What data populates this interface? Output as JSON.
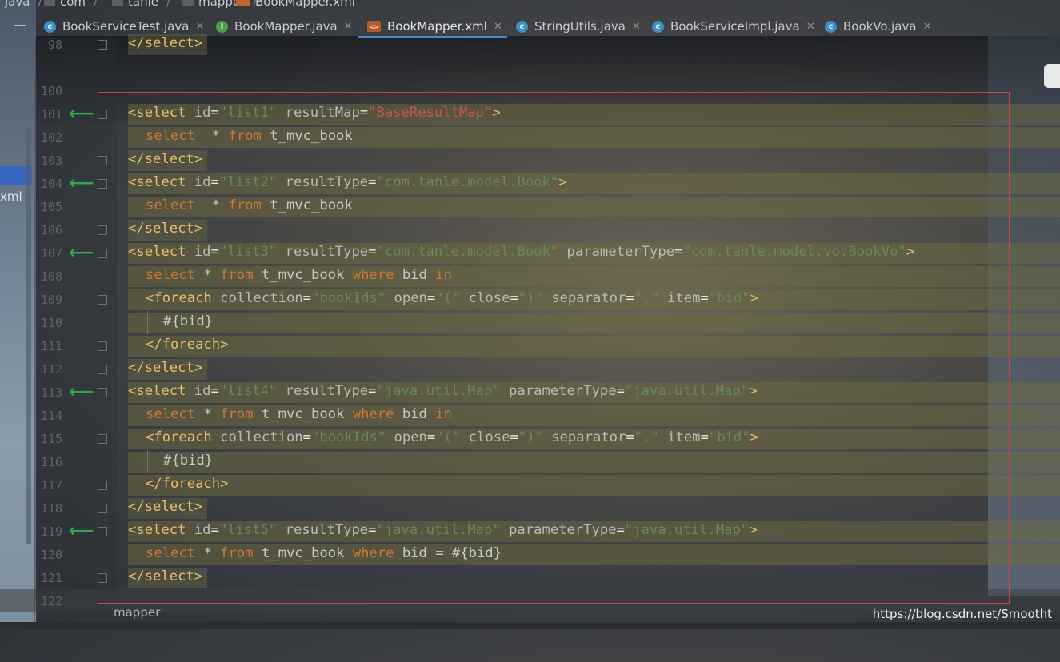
{
  "breadcrumb": [
    "java",
    "com",
    "tanle",
    "mapper",
    "BookMapper.xml"
  ],
  "tabs": [
    {
      "label": "BookServiceTest.java",
      "icon": "class-icon",
      "active": false
    },
    {
      "label": "BookMapper.java",
      "icon": "interface-icon",
      "active": false
    },
    {
      "label": "BookMapper.xml",
      "icon": "xml-file-icon",
      "active": true
    },
    {
      "label": "StringUtils.java",
      "icon": "class-icon",
      "active": false
    },
    {
      "label": "BookServiceImpl.java",
      "icon": "class-icon",
      "active": false
    },
    {
      "label": "BookVo.java",
      "icon": "class-icon",
      "active": false
    }
  ],
  "side_label": "xml",
  "line_numbers": [
    "98",
    "100",
    "101",
    "102",
    "103",
    "104",
    "105",
    "106",
    "107",
    "108",
    "109",
    "110",
    "111",
    "112",
    "113",
    "114",
    "115",
    "116",
    "117",
    "118",
    "119",
    "120",
    "121",
    "122"
  ],
  "code": {
    "l98": "</select>",
    "l101": {
      "open": "<select",
      "id_attr": "id",
      "id_val": "\"list1\"",
      "rm_attr": "resultMap",
      "rm_val": "\"BaseResultMap\"",
      "close": ">"
    },
    "l102": {
      "kw": "select",
      "rest": "  * ",
      "kw2": "from",
      "rest2": " t_mvc_book"
    },
    "l103": "</select>",
    "l104": {
      "open": "<select",
      "id_attr": "id",
      "id_val": "\"list2\"",
      "rt_attr": "resultType",
      "rt_val": "\"com.tanle.model.Book\"",
      "close": ">"
    },
    "l105": {
      "kw": "select",
      "rest": "  * ",
      "kw2": "from",
      "rest2": " t_mvc_book"
    },
    "l106": "</select>",
    "l107": {
      "open": "<select",
      "id_attr": "id",
      "id_val": "\"list3\"",
      "rt_attr": "resultType",
      "rt_val": "\"com.tanle.model.Book\"",
      "pt_attr": "parameterType",
      "pt_val": "\"com.tanle.model.vo.BookVo\"",
      "close": ">"
    },
    "l108": {
      "kw": "select",
      "rest": " * ",
      "kw2": "from",
      "rest2": " t_mvc_book ",
      "kw3": "where",
      "rest3": " bid ",
      "kw4": "in"
    },
    "l109": {
      "open": "<foreach",
      "a1": "collection",
      "v1": "\"bookIds\"",
      "a2": "open",
      "v2": "\"(\"",
      "a3": "close",
      "v3": "\")\"",
      "a4": "separator",
      "v4": "\",\"",
      "a5": "item",
      "v5": "\"bid\"",
      "close": ">"
    },
    "l110": "#{bid}",
    "l111": "</foreach>",
    "l112": "</select>",
    "l113": {
      "open": "<select",
      "id_attr": "id",
      "id_val": "\"list4\"",
      "rt_attr": "resultType",
      "rt_val": "\"java.util.Map\"",
      "pt_attr": "parameterType",
      "pt_val": "\"java.util.Map\"",
      "close": ">"
    },
    "l114": {
      "kw": "select",
      "rest": " * ",
      "kw2": "from",
      "rest2": " t_mvc_book ",
      "kw3": "where",
      "rest3": " bid ",
      "kw4": "in"
    },
    "l115": {
      "open": "<foreach",
      "a1": "collection",
      "v1": "\"bookIds\"",
      "a2": "open",
      "v2": "\"(\"",
      "a3": "close",
      "v3": "\")\"",
      "a4": "separator",
      "v4": "\",\"",
      "a5": "item",
      "v5": "\"bid\"",
      "close": ">"
    },
    "l116": "#{bid}",
    "l117": "</foreach>",
    "l118": "</select>",
    "l119": {
      "open": "<select",
      "id_attr": "id",
      "id_val": "\"list5\"",
      "rt_attr": "resultType",
      "rt_val": "\"java.util.Map\"",
      "pt_attr": "parameterType",
      "pt_val": "\"java.util.Map\"",
      "close": ">"
    },
    "l120": {
      "kw": "select",
      "rest": " * ",
      "kw2": "from",
      "rest2": " t_mvc_book ",
      "kw3": "where",
      "rest3": " bid = #{bid}"
    },
    "l121": "</select>"
  },
  "status_left": "mapper",
  "watermark": "https://blog.csdn.net/Smootht",
  "colors": {
    "tag": "#e8bf6a",
    "string": "#6a8759",
    "keyword": "#cc7832",
    "error_string": "#c75450",
    "arrow": "#2ba84a",
    "selection_box": "#d0404a",
    "active_tab": "#4a88c7"
  }
}
